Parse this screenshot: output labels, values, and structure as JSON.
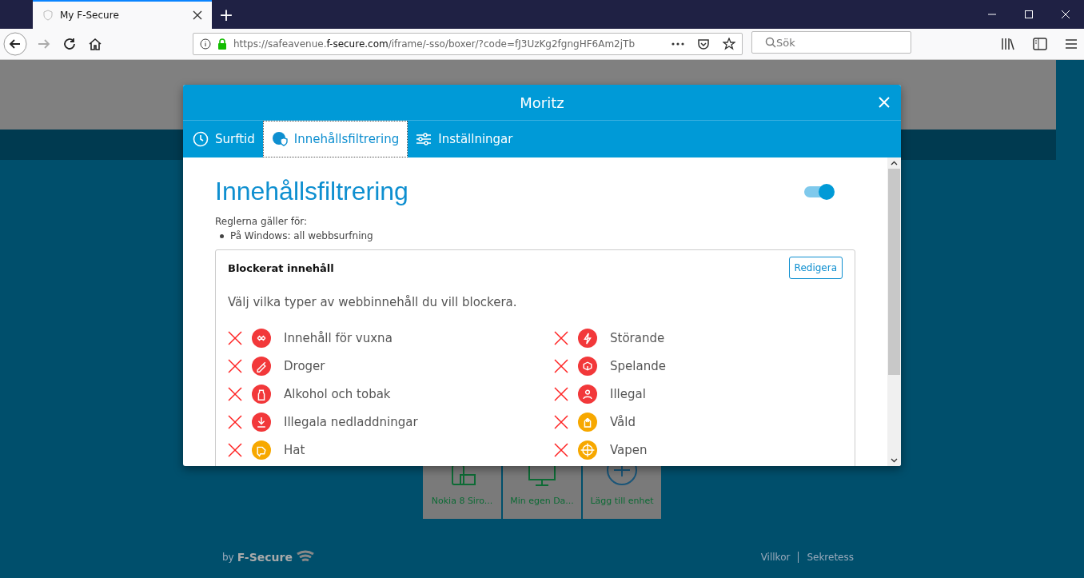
{
  "browser": {
    "tab_title": "My F-Secure",
    "url_prefix": "https://safeavenue.",
    "url_domain": "f-secure.com",
    "url_path": "/iframe/-sso/boxer/?code=fJ3UzKg2fgngHF6Am2jTb",
    "search_placeholder": "Sök",
    "new_tab": "+"
  },
  "modal": {
    "title": "Moritz",
    "tabs": [
      {
        "label": "Surftid",
        "selected": false,
        "kind": "clock"
      },
      {
        "label": "Innehållsfiltrering",
        "selected": true,
        "kind": "globe"
      },
      {
        "label": "Inställningar",
        "selected": false,
        "kind": "sliders"
      }
    ],
    "heading": "Innehållsfiltrering",
    "enabled": true,
    "rules_label": "Reglerna gäller för:",
    "rules": [
      "På Windows: all webbsurfning"
    ],
    "card": {
      "title": "Blockerat innehåll",
      "edit_button": "Redigera",
      "description": "Välj vilka typer av webbinnehåll du vill blockera.",
      "categories": [
        {
          "label": "Innehåll för vuxna",
          "blocked": true,
          "color": "#f2383a"
        },
        {
          "label": "Störande",
          "blocked": true,
          "color": "#f2383a"
        },
        {
          "label": "Droger",
          "blocked": true,
          "color": "#f2383a"
        },
        {
          "label": "Spelande",
          "blocked": true,
          "color": "#f2383a"
        },
        {
          "label": "Alkohol och tobak",
          "blocked": true,
          "color": "#f2383a"
        },
        {
          "label": "Illegal",
          "blocked": true,
          "color": "#f2383a"
        },
        {
          "label": "Illegala nedladdningar",
          "blocked": true,
          "color": "#f2383a"
        },
        {
          "label": "Våld",
          "blocked": true,
          "color": "#f7a800"
        },
        {
          "label": "Hat",
          "blocked": true,
          "color": "#f7a800"
        },
        {
          "label": "Vapen",
          "blocked": true,
          "color": "#f7a800"
        }
      ]
    }
  },
  "devices": [
    {
      "label": "Nokia 8 Siro...",
      "kind": "phone"
    },
    {
      "label": "Min egen Da...",
      "kind": "monitor"
    },
    {
      "label": "Lägg till enhet",
      "kind": "add"
    }
  ],
  "footer": {
    "by": "by",
    "brand": "F-Secure",
    "links": [
      "Villkor",
      "Sekretess"
    ]
  }
}
